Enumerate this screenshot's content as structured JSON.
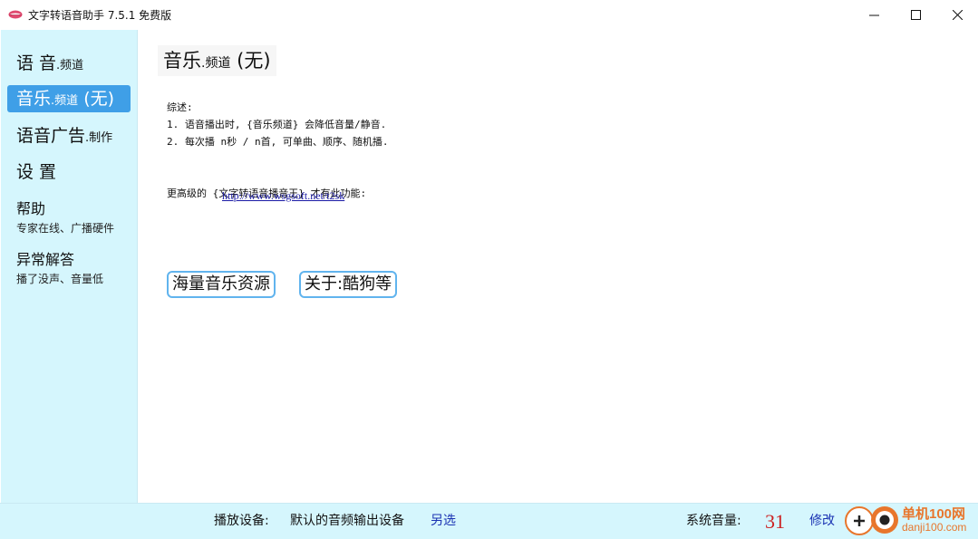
{
  "window": {
    "title": "文字转语音助手 7.5.1 免费版",
    "minimize_symbol": "—",
    "icon": "lips-icon"
  },
  "sidebar": {
    "items": [
      {
        "main": "语 音",
        "sub": ".频道",
        "desc": ""
      },
      {
        "main": "音乐",
        "sub": ".频道",
        "tail": " (无)",
        "desc": ""
      },
      {
        "main": "语音广告",
        "sub": ".制作",
        "desc": ""
      },
      {
        "main": "设 置",
        "sub": "",
        "desc": ""
      },
      {
        "main": "帮助",
        "sub": "",
        "desc": "专家在线、广播硬件"
      },
      {
        "main": "异常解答",
        "sub": "",
        "desc": "播了没声、音量低"
      }
    ],
    "selected_index": 1
  },
  "main": {
    "title_main": "音乐",
    "title_sub": ".频道",
    "title_tail": " (无)",
    "description": "综述:\n1. 语音播出时, {音乐频道} 会降低音量/静音.\n2. 每次播 n秒 / n首, 可单曲、顺序、随机播.\n\n\n更高级的 {文字转语音播音王} 才有此功能:",
    "link": "http://www.wsgsoft.net/t2sk",
    "buttons": {
      "music_resources": "海量音乐资源",
      "about": "关于:酷狗等"
    }
  },
  "statusbar": {
    "device_label": "播放设备:",
    "device_value": "默认的音频输出设备",
    "choose_other": "另选",
    "volume_label": "系统音量:",
    "volume_value": "31",
    "modify": "修改"
  },
  "watermark": {
    "name": "单机100网",
    "domain": "danji100.com",
    "color": "#e8762c"
  },
  "colors": {
    "sidebar_bg": "#d5f6fd",
    "selected_bg": "#3f9fe7",
    "button_border": "#61b4ee",
    "volume": "#cc2222"
  }
}
